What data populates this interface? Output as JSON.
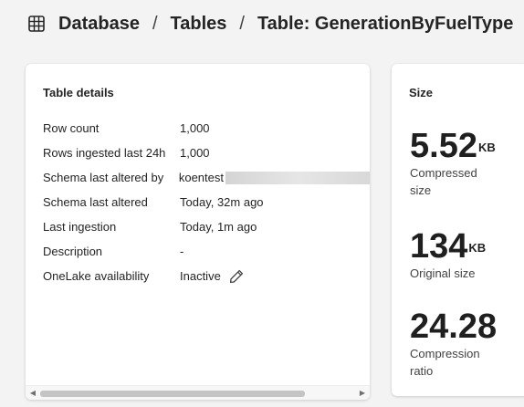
{
  "breadcrumb": {
    "icon": "table-grid-icon",
    "items": [
      "Database",
      "Tables",
      "Table: GenerationByFuelType"
    ],
    "separator": "/"
  },
  "details": {
    "title": "Table details",
    "rows": [
      {
        "key": "Row count",
        "value": "1,000"
      },
      {
        "key": "Rows ingested last 24h",
        "value": "1,000"
      },
      {
        "key": "Schema last altered by",
        "value": "koentest"
      },
      {
        "key": "Schema last altered",
        "value": "Today, 32m ago"
      },
      {
        "key": "Last ingestion",
        "value": "Today, 1m ago"
      },
      {
        "key": "Description",
        "value": "-"
      },
      {
        "key": "OneLake availability",
        "value": "Inactive"
      }
    ],
    "scroll_left": "◀",
    "scroll_right": "▶"
  },
  "size": {
    "title": "Size",
    "compressed": {
      "value": "5.52",
      "unit": "KB",
      "label": "Compressed size"
    },
    "original": {
      "value": "134",
      "unit": "KB",
      "label": "Original size"
    },
    "ratio": {
      "value": "24.28",
      "label": "Compression ratio"
    }
  }
}
